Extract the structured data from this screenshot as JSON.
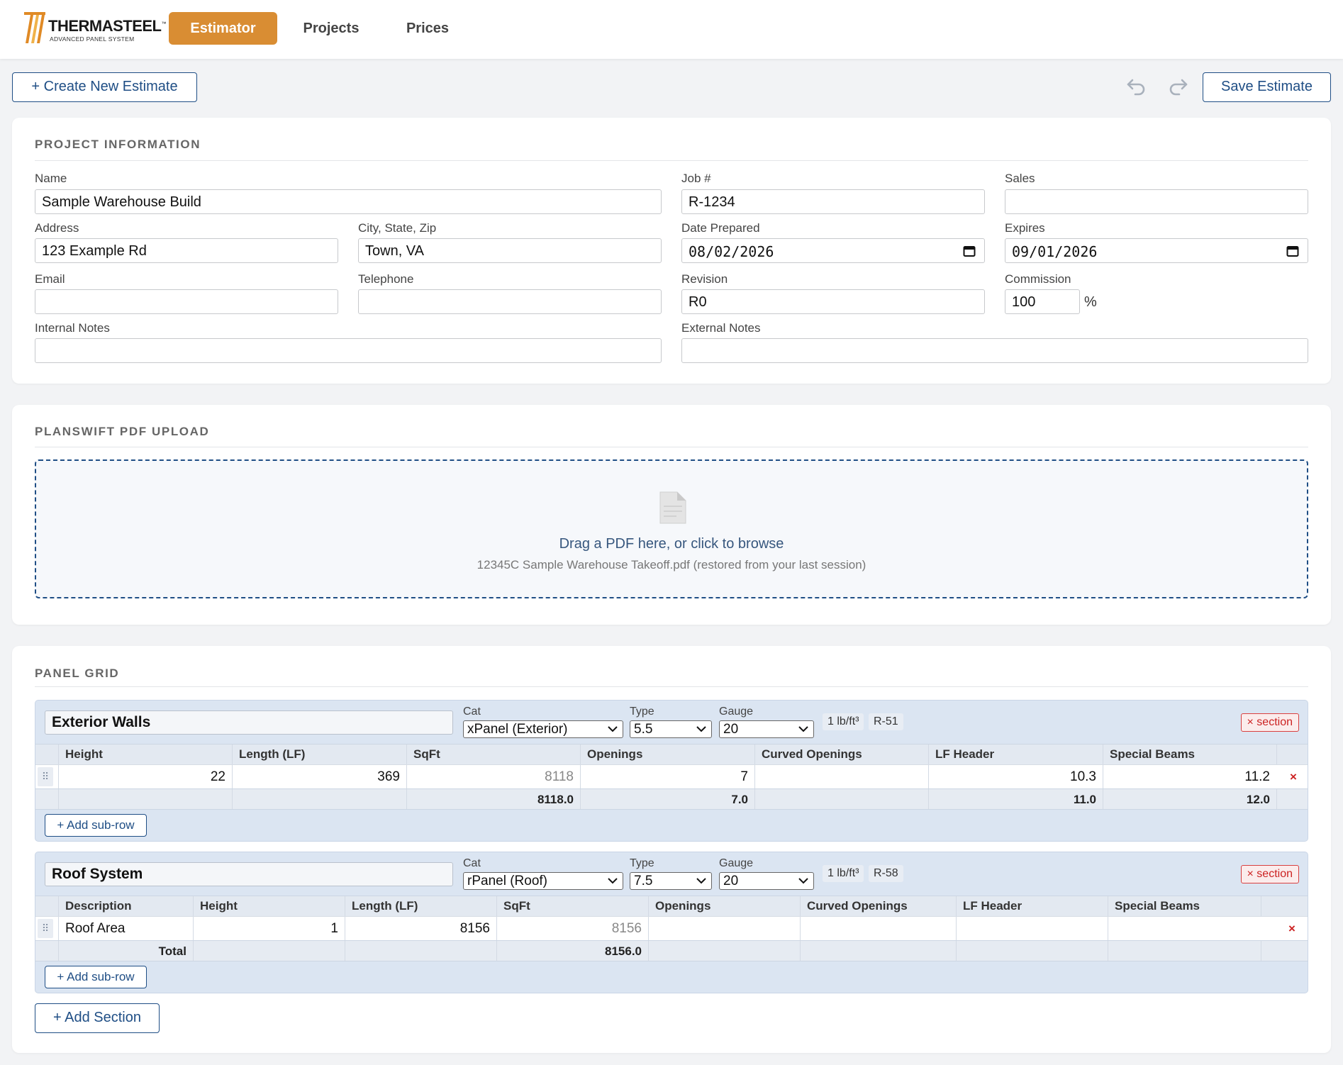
{
  "brand": {
    "name": "THERMASTEEL",
    "tagline": "ADVANCED PANEL SYSTEM",
    "accent": "#d98d33",
    "primary": "#1f4e85"
  },
  "nav": {
    "tabs": [
      {
        "label": "Estimator",
        "active": true
      },
      {
        "label": "Projects"
      },
      {
        "label": "Prices"
      }
    ]
  },
  "toolbar": {
    "create_label": "+ Create New Estimate",
    "undo_icon": "undo-icon",
    "redo_icon": "redo-icon",
    "save_label": "Save Estimate"
  },
  "project": {
    "title": "PROJECT INFORMATION",
    "name_label": "Name",
    "name": "Sample Warehouse Build",
    "job_label": "Job #",
    "job": "R-1234",
    "sales_label": "Sales",
    "sales": "",
    "address_label": "Address",
    "address": "123 Example Rd",
    "city_label": "City, State, Zip",
    "city": "Town, VA",
    "date_label": "Date Prepared",
    "date": "08/02/2026",
    "expires_label": "Expires",
    "expires": "09/01/2026",
    "email_label": "Email",
    "email": "",
    "phone_label": "Telephone",
    "phone": "",
    "revision_label": "Revision",
    "revision": "R0",
    "commission_label": "Commission",
    "commission": "100",
    "commission_unit": "%",
    "internal_label": "Internal Notes",
    "internal": "",
    "external_label": "External Notes",
    "external": ""
  },
  "upload": {
    "title": "PLANSWIFT PDF UPLOAD",
    "icon": "document-icon",
    "prompt": "Drag a PDF here, or click to browse",
    "restored": "12345C Sample Warehouse Takeoff.pdf (restored from your last session)"
  },
  "panel_grid": {
    "title": "PANEL GRID",
    "remove_section_label": "× section",
    "add_subrow_label": "+ Add sub-row",
    "add_section_label": "+ Add Section",
    "cat_label": "Cat",
    "type_label": "Type",
    "gauge_label": "Gauge",
    "sections": [
      {
        "name": "Exterior Walls",
        "cat": "xPanel (Exterior)",
        "type": "5.5",
        "gauge": "20",
        "density": "1 lb/ft³",
        "rvalue": "R-51",
        "headers": [
          "Height",
          "Length (LF)",
          "SqFt",
          "Openings",
          "Curved Openings",
          "LF Header",
          "Special Beams"
        ],
        "rows": [
          {
            "height": "22",
            "length": "369",
            "sqft": "8118",
            "openings": "7",
            "curved": "",
            "lf_header": "10.3",
            "special_beams": "11.2"
          }
        ],
        "totals": {
          "sqft": "8118.0",
          "openings": "7.0",
          "lf_header": "11.0",
          "special_beams": "12.0"
        }
      },
      {
        "name": "Roof System",
        "cat": "rPanel (Roof)",
        "type": "7.5",
        "gauge": "20",
        "density": "1 lb/ft³",
        "rvalue": "R-58",
        "headers": [
          "Description",
          "Height",
          "Length (LF)",
          "SqFt",
          "Openings",
          "Curved Openings",
          "LF Header",
          "Special Beams"
        ],
        "rows": [
          {
            "description": "Roof Area",
            "height": "1",
            "length": "8156",
            "sqft": "8156",
            "openings": "",
            "curved": "",
            "lf_header": "",
            "special_beams": ""
          }
        ],
        "totals": {
          "label": "Total",
          "sqft": "8156.0"
        }
      }
    ]
  }
}
